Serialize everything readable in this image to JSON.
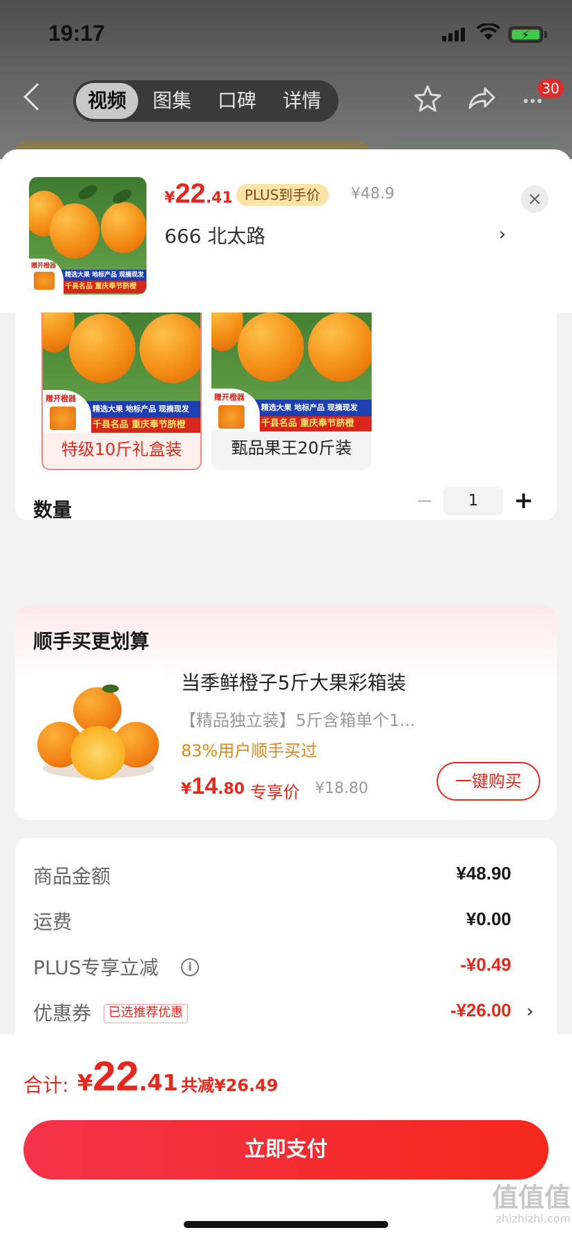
{
  "status": {
    "time": "19:17"
  },
  "nav": {
    "tabs": [
      "视频",
      "图集",
      "口碑",
      "详情"
    ],
    "active_tab": 0,
    "badge_count": "30"
  },
  "sheet": {
    "price": {
      "currency": "¥",
      "integer": "22",
      "decimal": ".41"
    },
    "plus_tag": "PLUS到手价",
    "original_price": "¥48.9",
    "address": "666  北太路",
    "close": "×",
    "chevron": "›"
  },
  "product_image": {
    "stamp_text": "赠开橙器",
    "band1": "精选大果 地标产品 现摘现发",
    "band2": "千县名品 重庆奉节脐橙"
  },
  "specs": [
    {
      "label": "特级10斤礼盒装",
      "selected": true
    },
    {
      "label": "甄品果王20斤装",
      "selected": false
    }
  ],
  "quantity": {
    "label": "数量",
    "minus": "−",
    "value": "1",
    "plus": "+"
  },
  "upsell": {
    "title": "顺手买更划算",
    "name": "当季鲜橙子5斤大果彩箱装",
    "desc": "【精品独立装】5斤含箱单个1...",
    "rate": "83%用户顺手买过",
    "price": {
      "currency": "¥",
      "integer": "14",
      "decimal": ".80"
    },
    "exclusive": "专享价",
    "original": "¥18.80",
    "button": "一键购买"
  },
  "summary": {
    "rows": [
      {
        "label": "商品金额",
        "value": "¥48.90"
      },
      {
        "label": "运费",
        "value": "¥0.00"
      },
      {
        "label": "PLUS专享立减",
        "value": "-¥0.49"
      },
      {
        "label": "优惠券",
        "value": "-¥26.00"
      }
    ],
    "coupon_tag": "已选推荐优惠",
    "info": "i",
    "chevron": "›"
  },
  "footer": {
    "total_label": "合计:",
    "total": {
      "currency": "¥",
      "integer": "22",
      "decimal": ".41"
    },
    "saved": "共减¥26.49",
    "pay_button": "立即支付"
  },
  "watermark": {
    "main": "值值值",
    "sub": "zhizhizhi.com"
  },
  "colors": {
    "accent": "#e4281e",
    "plus_gold": "#fbe3a8",
    "battery": "#41c74a"
  }
}
